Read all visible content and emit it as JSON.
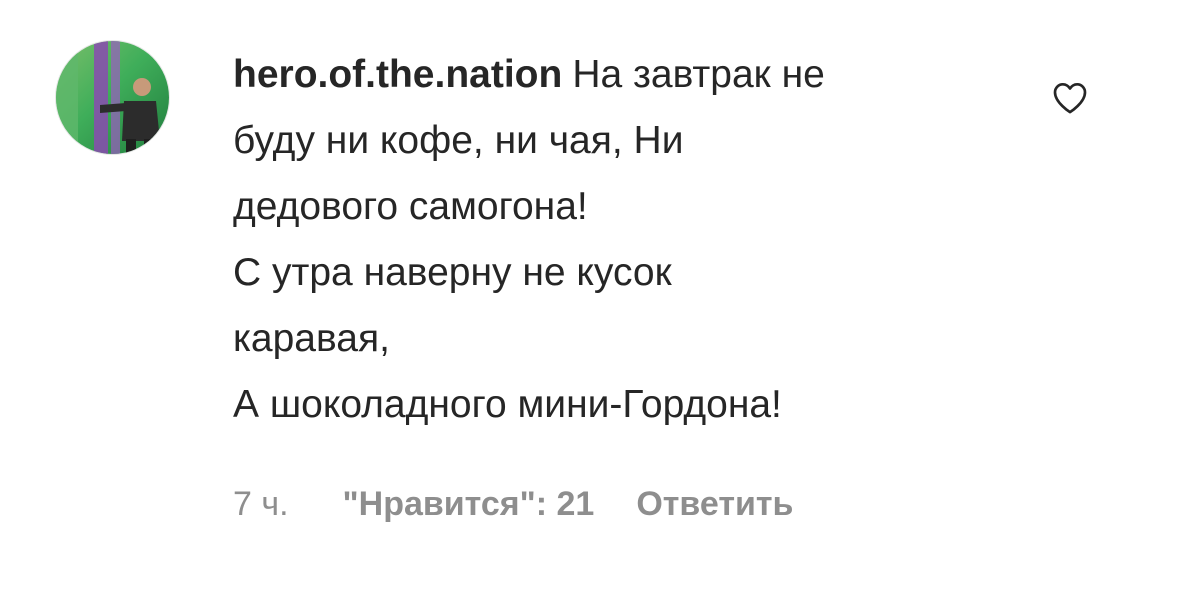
{
  "comment": {
    "username": "hero.of.the.nation",
    "text_lines": [
      "На завтрак не",
      "буду ни кофе, ни чая, Ни",
      "дедового самогона!",
      "С утра наверну не кусок",
      "каравая,",
      "А шоколадного мини-Гордона!"
    ],
    "time": "7 ч.",
    "likes": "\"Нравится\": 21",
    "reply_label": "Ответить",
    "like_icon": "heart-outline-icon",
    "avatar_icon": "user-avatar"
  },
  "colors": {
    "text": "#262626",
    "meta": "#8e8e8e",
    "background": "#ffffff"
  }
}
